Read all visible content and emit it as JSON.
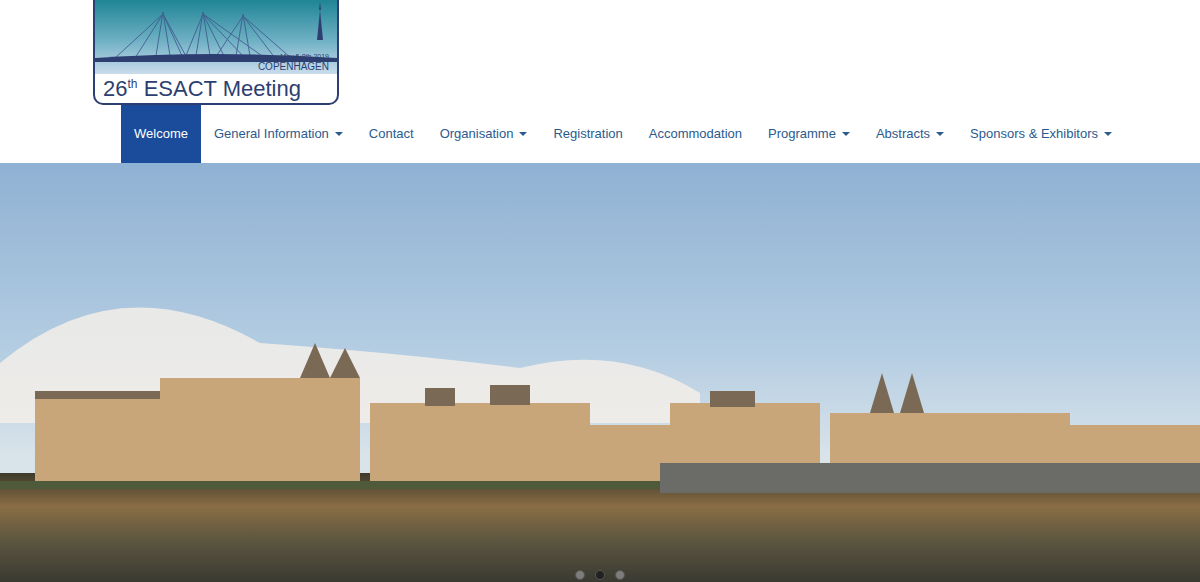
{
  "logo": {
    "date": "May 5-8th 2019",
    "city": "COPENHAGEN",
    "number": "26",
    "ordinal": "th",
    "title": "ESACT Meeting"
  },
  "nav": [
    {
      "label": "Welcome",
      "selected": true,
      "dropdown": false
    },
    {
      "label": "General Information",
      "selected": false,
      "dropdown": true
    },
    {
      "label": "Contact",
      "selected": false,
      "dropdown": false
    },
    {
      "label": "Organisation",
      "selected": false,
      "dropdown": true
    },
    {
      "label": "Registration",
      "selected": false,
      "dropdown": false
    },
    {
      "label": "Accommodation",
      "selected": false,
      "dropdown": false
    },
    {
      "label": "Programme",
      "selected": false,
      "dropdown": true
    },
    {
      "label": "Abstracts",
      "selected": false,
      "dropdown": true
    },
    {
      "label": "Sponsors & Exhibitors",
      "selected": false,
      "dropdown": true
    }
  ],
  "carousel": {
    "indicators": [
      {
        "selected": false
      },
      {
        "selected": true
      },
      {
        "selected": false
      }
    ]
  }
}
